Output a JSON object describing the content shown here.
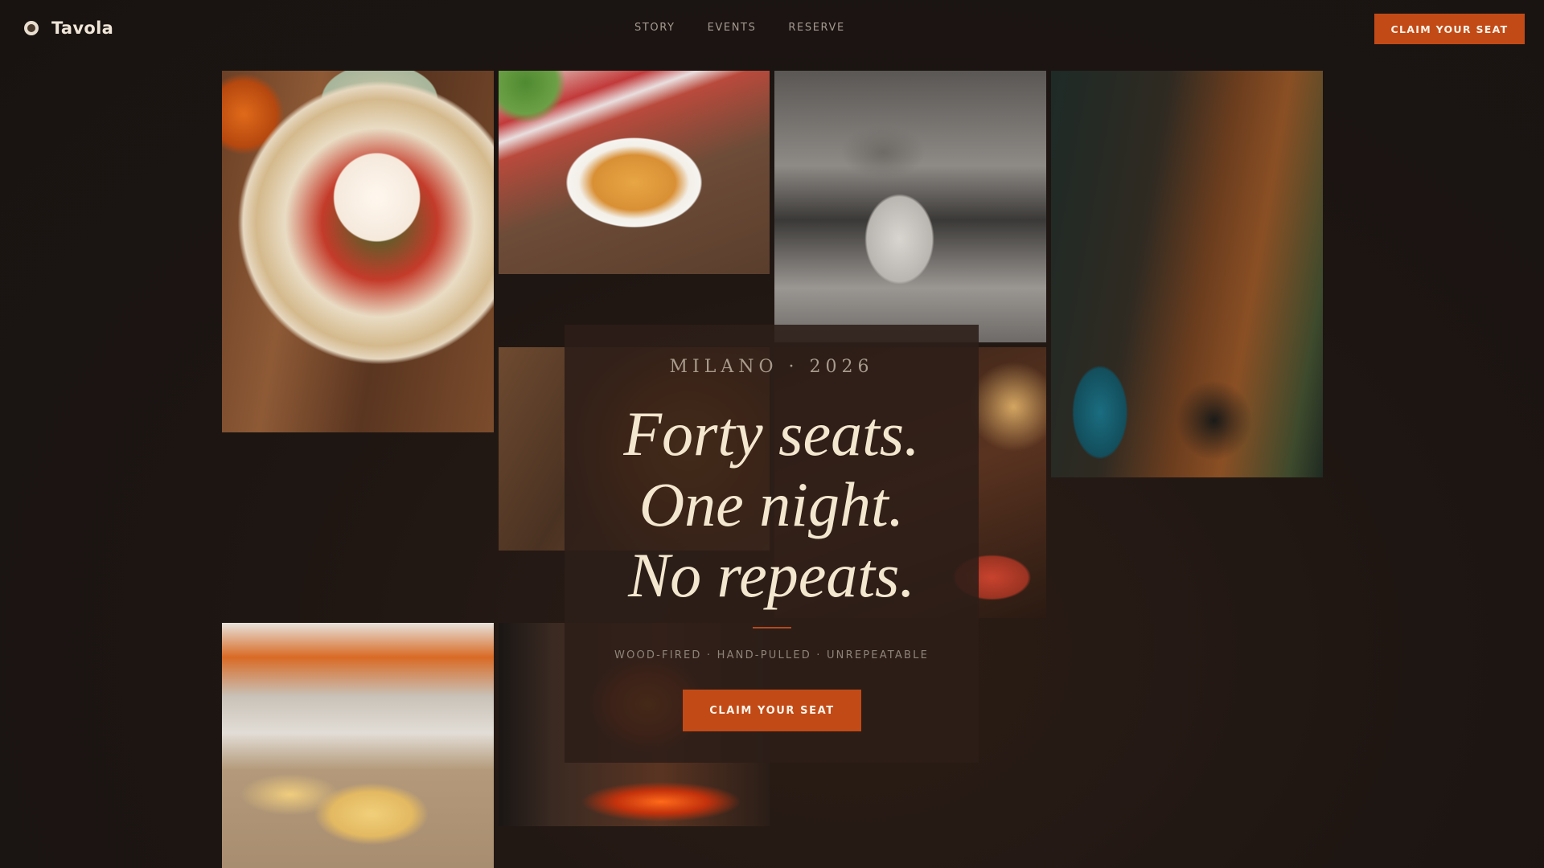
{
  "header": {
    "brand_name": "Tavola",
    "nav": [
      "STORY",
      "EVENTS",
      "RESERVE"
    ],
    "cta_label": "CLAIM YOUR SEAT"
  },
  "hero": {
    "eyebrow": "MILANO · 2026",
    "headline": [
      "Forty seats.",
      "One night.",
      "No repeats."
    ],
    "tagline": "WOOD-FIRED · HAND-PULLED · UNREPEATABLE",
    "cta_label": "CLAIM YOUR SEAT"
  },
  "colors": {
    "accent": "#c14a17",
    "background": "#1c1512",
    "headline": "#f4e7cf"
  }
}
